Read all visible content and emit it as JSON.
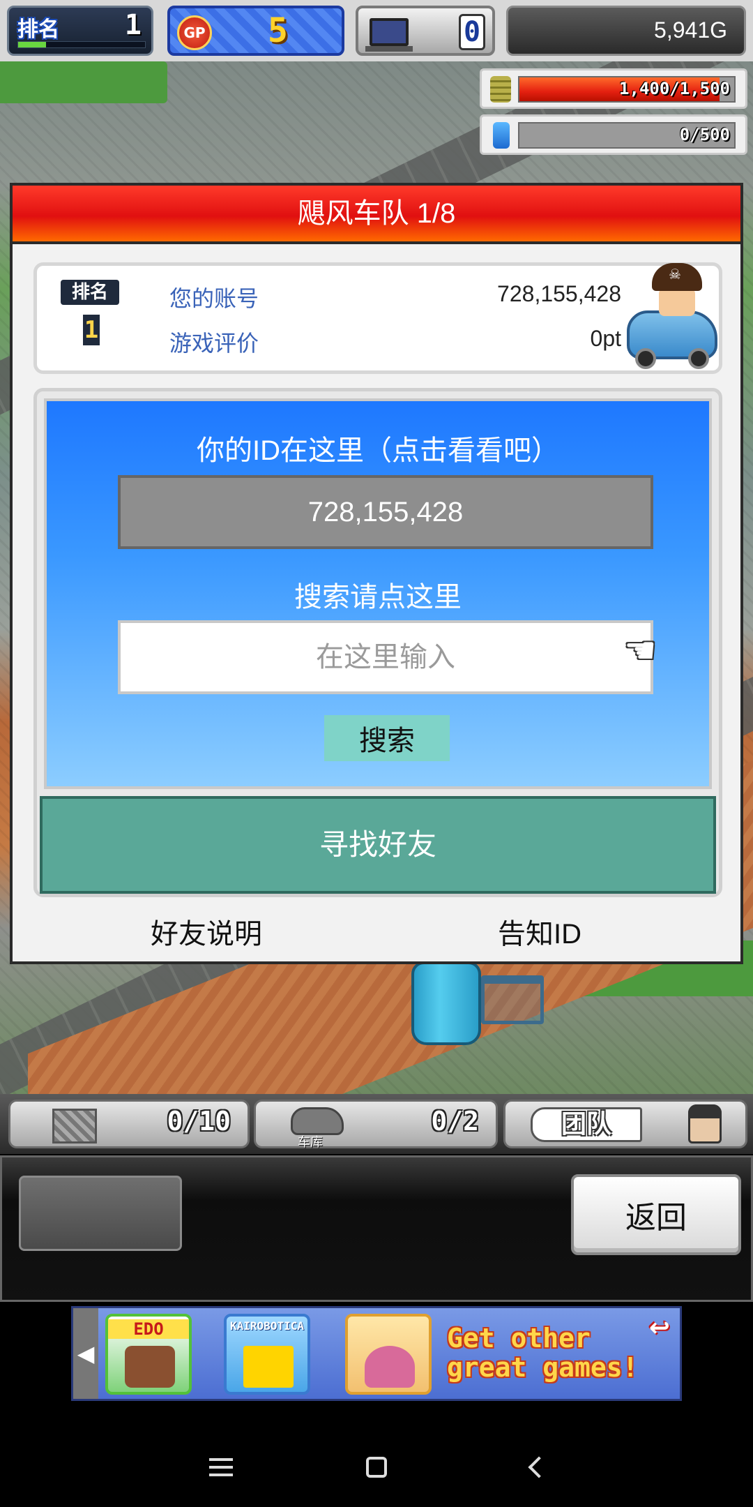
{
  "hud": {
    "rank_label": "排名",
    "rank_value": "1",
    "rank_progress": 0.22,
    "gp_label": "GP",
    "gp_value": "5",
    "pc_value": "0",
    "gold": "5,941G",
    "fuel": {
      "text": "1,400/1,500",
      "current": 1400,
      "max": 1500,
      "icon": "coin-stack-icon"
    },
    "energy": {
      "text": "0/500",
      "current": 0,
      "max": 500,
      "icon": "bottle-icon"
    }
  },
  "dialog": {
    "title": "飓风车队 1/8",
    "account": {
      "rank_badge": "排名",
      "rank_number": "1",
      "rows": [
        {
          "label": "您的账号",
          "value": "728,155,428"
        },
        {
          "label": "游戏评价",
          "value": "0pt"
        }
      ]
    },
    "id_panel": {
      "heading": "你的ID在这里（点击看看吧）",
      "id_value": "728,155,428",
      "search_heading": "搜索请点这里",
      "search_placeholder": "在这里输入",
      "search_button": "搜索"
    },
    "find_friend_button": "寻找好友",
    "footer": {
      "friend_help": "好友说明",
      "tell_id": "告知ID"
    }
  },
  "status_strip": {
    "slot1_count": "0/10",
    "slot2_label": "车库",
    "slot2_count": "0/2",
    "slot3_label": "团队"
  },
  "controls": {
    "back_button": "返回"
  },
  "ad": {
    "edo_title": "EDO",
    "kairo_title": "KAIROBOTICA",
    "promo_text": "Get other great games!"
  }
}
